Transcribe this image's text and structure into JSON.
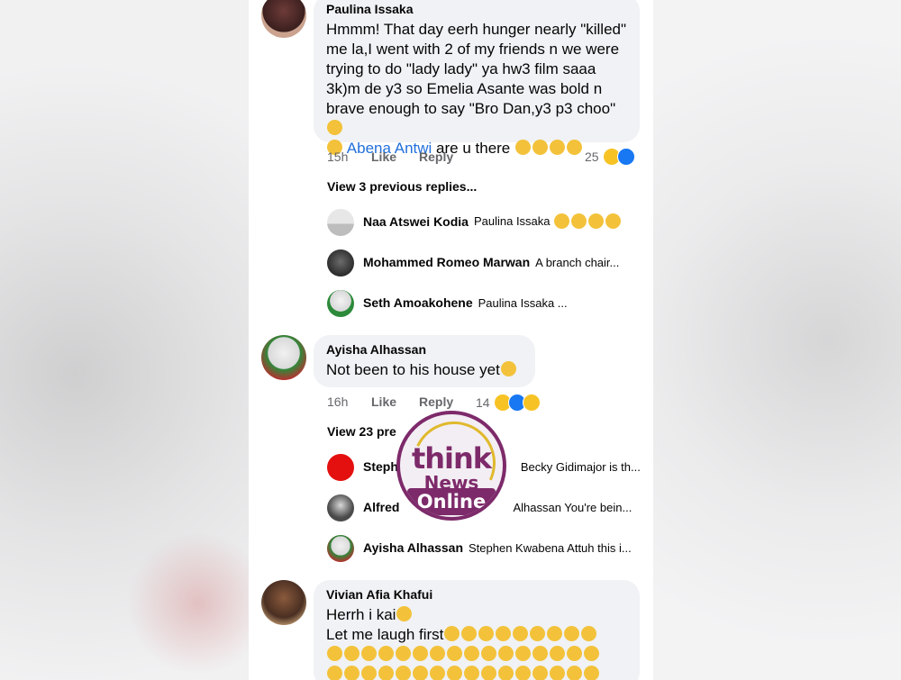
{
  "comments": [
    {
      "author": "Paulina Issaka",
      "text_lines": [
        "Hmmm! That day eerh hunger nearly \"killed\"",
        "me la,I went with 2 of my friends n we were",
        "trying to do \"lady lady\" ya hw3 film saaa",
        "3k)m de y3 so Emelia Asante was bold n",
        "brave enough to say \"Bro Dan,y3 p3 choo\""
      ],
      "mention": "Abena Antwi",
      "after_mention": "are u there",
      "time": "15h",
      "like": "Like",
      "reply": "Reply",
      "reaction_count": "25",
      "view_replies": "View 3 previous replies...",
      "replies": [
        {
          "name": "Naa Atswei Kodia",
          "text": "Paulina Issaka"
        },
        {
          "name": "Mohammed Romeo Marwan",
          "text": "A branch chair..."
        },
        {
          "name": "Seth Amoakohene",
          "text": "Paulina Issaka ..."
        }
      ]
    },
    {
      "author": "Ayisha Alhassan",
      "text": "Not been to his house yet",
      "time": "16h",
      "like": "Like",
      "reply": "Reply",
      "reaction_count": "14",
      "view_replies": "View 23 pre",
      "replies": [
        {
          "name": "Steph",
          "text": "Becky Gidimajor is th..."
        },
        {
          "name": "Alfred",
          "text": "Alhassan You're bein..."
        },
        {
          "name": "Ayisha Alhassan",
          "text": "Stephen Kwabena Attuh this i..."
        }
      ]
    },
    {
      "author": "Vivian Afia Khafui",
      "line1": "Herrh i kai",
      "line2": "Let me laugh first"
    }
  ],
  "watermark": {
    "line1": "think",
    "line2": "News",
    "line3": "Online"
  },
  "colors": {
    "bubble": "#f0f2f5",
    "mention": "#216fdb",
    "meta": "#65676b",
    "brand": "#7d2a6a"
  }
}
